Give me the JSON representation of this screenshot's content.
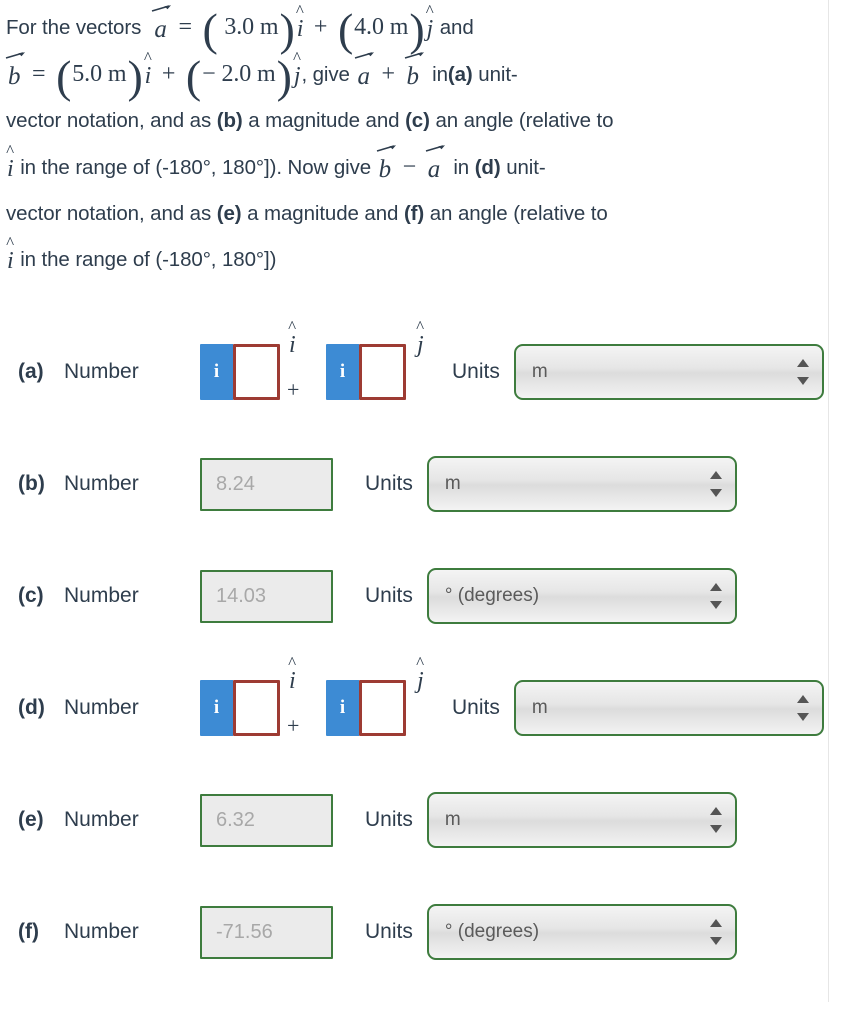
{
  "problem": {
    "line1": {
      "lead": "For the vectors",
      "vec_a": "a",
      "eq": "=",
      "open1": "(",
      "val1": "3.0 m",
      "close1": ")",
      "hat_i": "i",
      "plus": "+",
      "open2": "(",
      "val2": "4.0 m",
      "close2": ")",
      "hat_j": "j",
      "tail": "and"
    },
    "line2": {
      "vec_b": "b",
      "eq": "=",
      "open1": "(",
      "val1": "5.0 m",
      "close1": ")",
      "hat_i": "i",
      "plus": "+",
      "open2": "(",
      "val2": "− 2.0 m",
      "close2": ")",
      "hat_j": "j",
      "comma_give": ", give",
      "vec_a": "a",
      "op_plus": "+",
      "vec_b2": "b",
      "in_text": "in",
      "part_a": "(a)",
      "unit_hyphen": "unit-"
    },
    "line3": "vector notation, and as",
    "line3_b": "(b)",
    "line3_mid": "a magnitude and",
    "line3_c": "(c)",
    "line3_end": "an angle (relative to",
    "line4": {
      "hat_i": "i",
      "range": "in the range of (-180°, 180°]). Now give",
      "vec_b": "b",
      "minus": "−",
      "vec_a": "a",
      "in_text": "in",
      "part_d": "(d)",
      "unit_hyphen": "unit-"
    },
    "line5": "vector notation, and as",
    "line5_e": "(e)",
    "line5_mid": "a magnitude and",
    "line5_f": "(f)",
    "line5_end": "an angle (relative to",
    "line6": {
      "hat_i": "i",
      "range": "in the range of (-180°, 180°])"
    }
  },
  "labels": {
    "number": "Number",
    "units": "Units",
    "info_icon_text": "i"
  },
  "colors": {
    "text": "#2e3d4d",
    "info_button_blue": "#3d8bd4",
    "entry_border_red": "#9d3b33",
    "field_border_green": "#3e7c3e",
    "placeholder_gray": "#a8a8a8",
    "field_fill_gray": "#ebebeb"
  },
  "rows": [
    {
      "part": "(a)",
      "type": "vector",
      "number_label": "Number",
      "i_value": "",
      "i_placeholder": "",
      "j_value": "",
      "j_placeholder": "",
      "hat_i": "i",
      "hat_j": "j",
      "plus": "+",
      "units_label": "Units",
      "units_value": "m",
      "units_clipped": true
    },
    {
      "part": "(b)",
      "type": "scalar",
      "number_label": "Number",
      "number_value": "",
      "number_placeholder": "8.24",
      "units_label": "Units",
      "units_value": "m",
      "units_clipped": false
    },
    {
      "part": "(c)",
      "type": "scalar",
      "number_label": "Number",
      "number_value": "",
      "number_placeholder": "14.03",
      "units_label": "Units",
      "units_value": "° (degrees)",
      "units_clipped": false
    },
    {
      "part": "(d)",
      "type": "vector",
      "number_label": "Number",
      "i_value": "",
      "i_placeholder": "",
      "j_value": "",
      "j_placeholder": "",
      "hat_i": "i",
      "hat_j": "j",
      "plus": "+",
      "units_label": "Units",
      "units_value": "m",
      "units_clipped": true
    },
    {
      "part": "(e)",
      "type": "scalar",
      "number_label": "Number",
      "number_value": "",
      "number_placeholder": "6.32",
      "units_label": "Units",
      "units_value": "m",
      "units_clipped": false
    },
    {
      "part": "(f)",
      "type": "scalar",
      "number_label": "Number",
      "number_value": "",
      "number_placeholder": "-71.56",
      "units_label": "Units",
      "units_value": "° (degrees)",
      "units_clipped": false
    }
  ]
}
